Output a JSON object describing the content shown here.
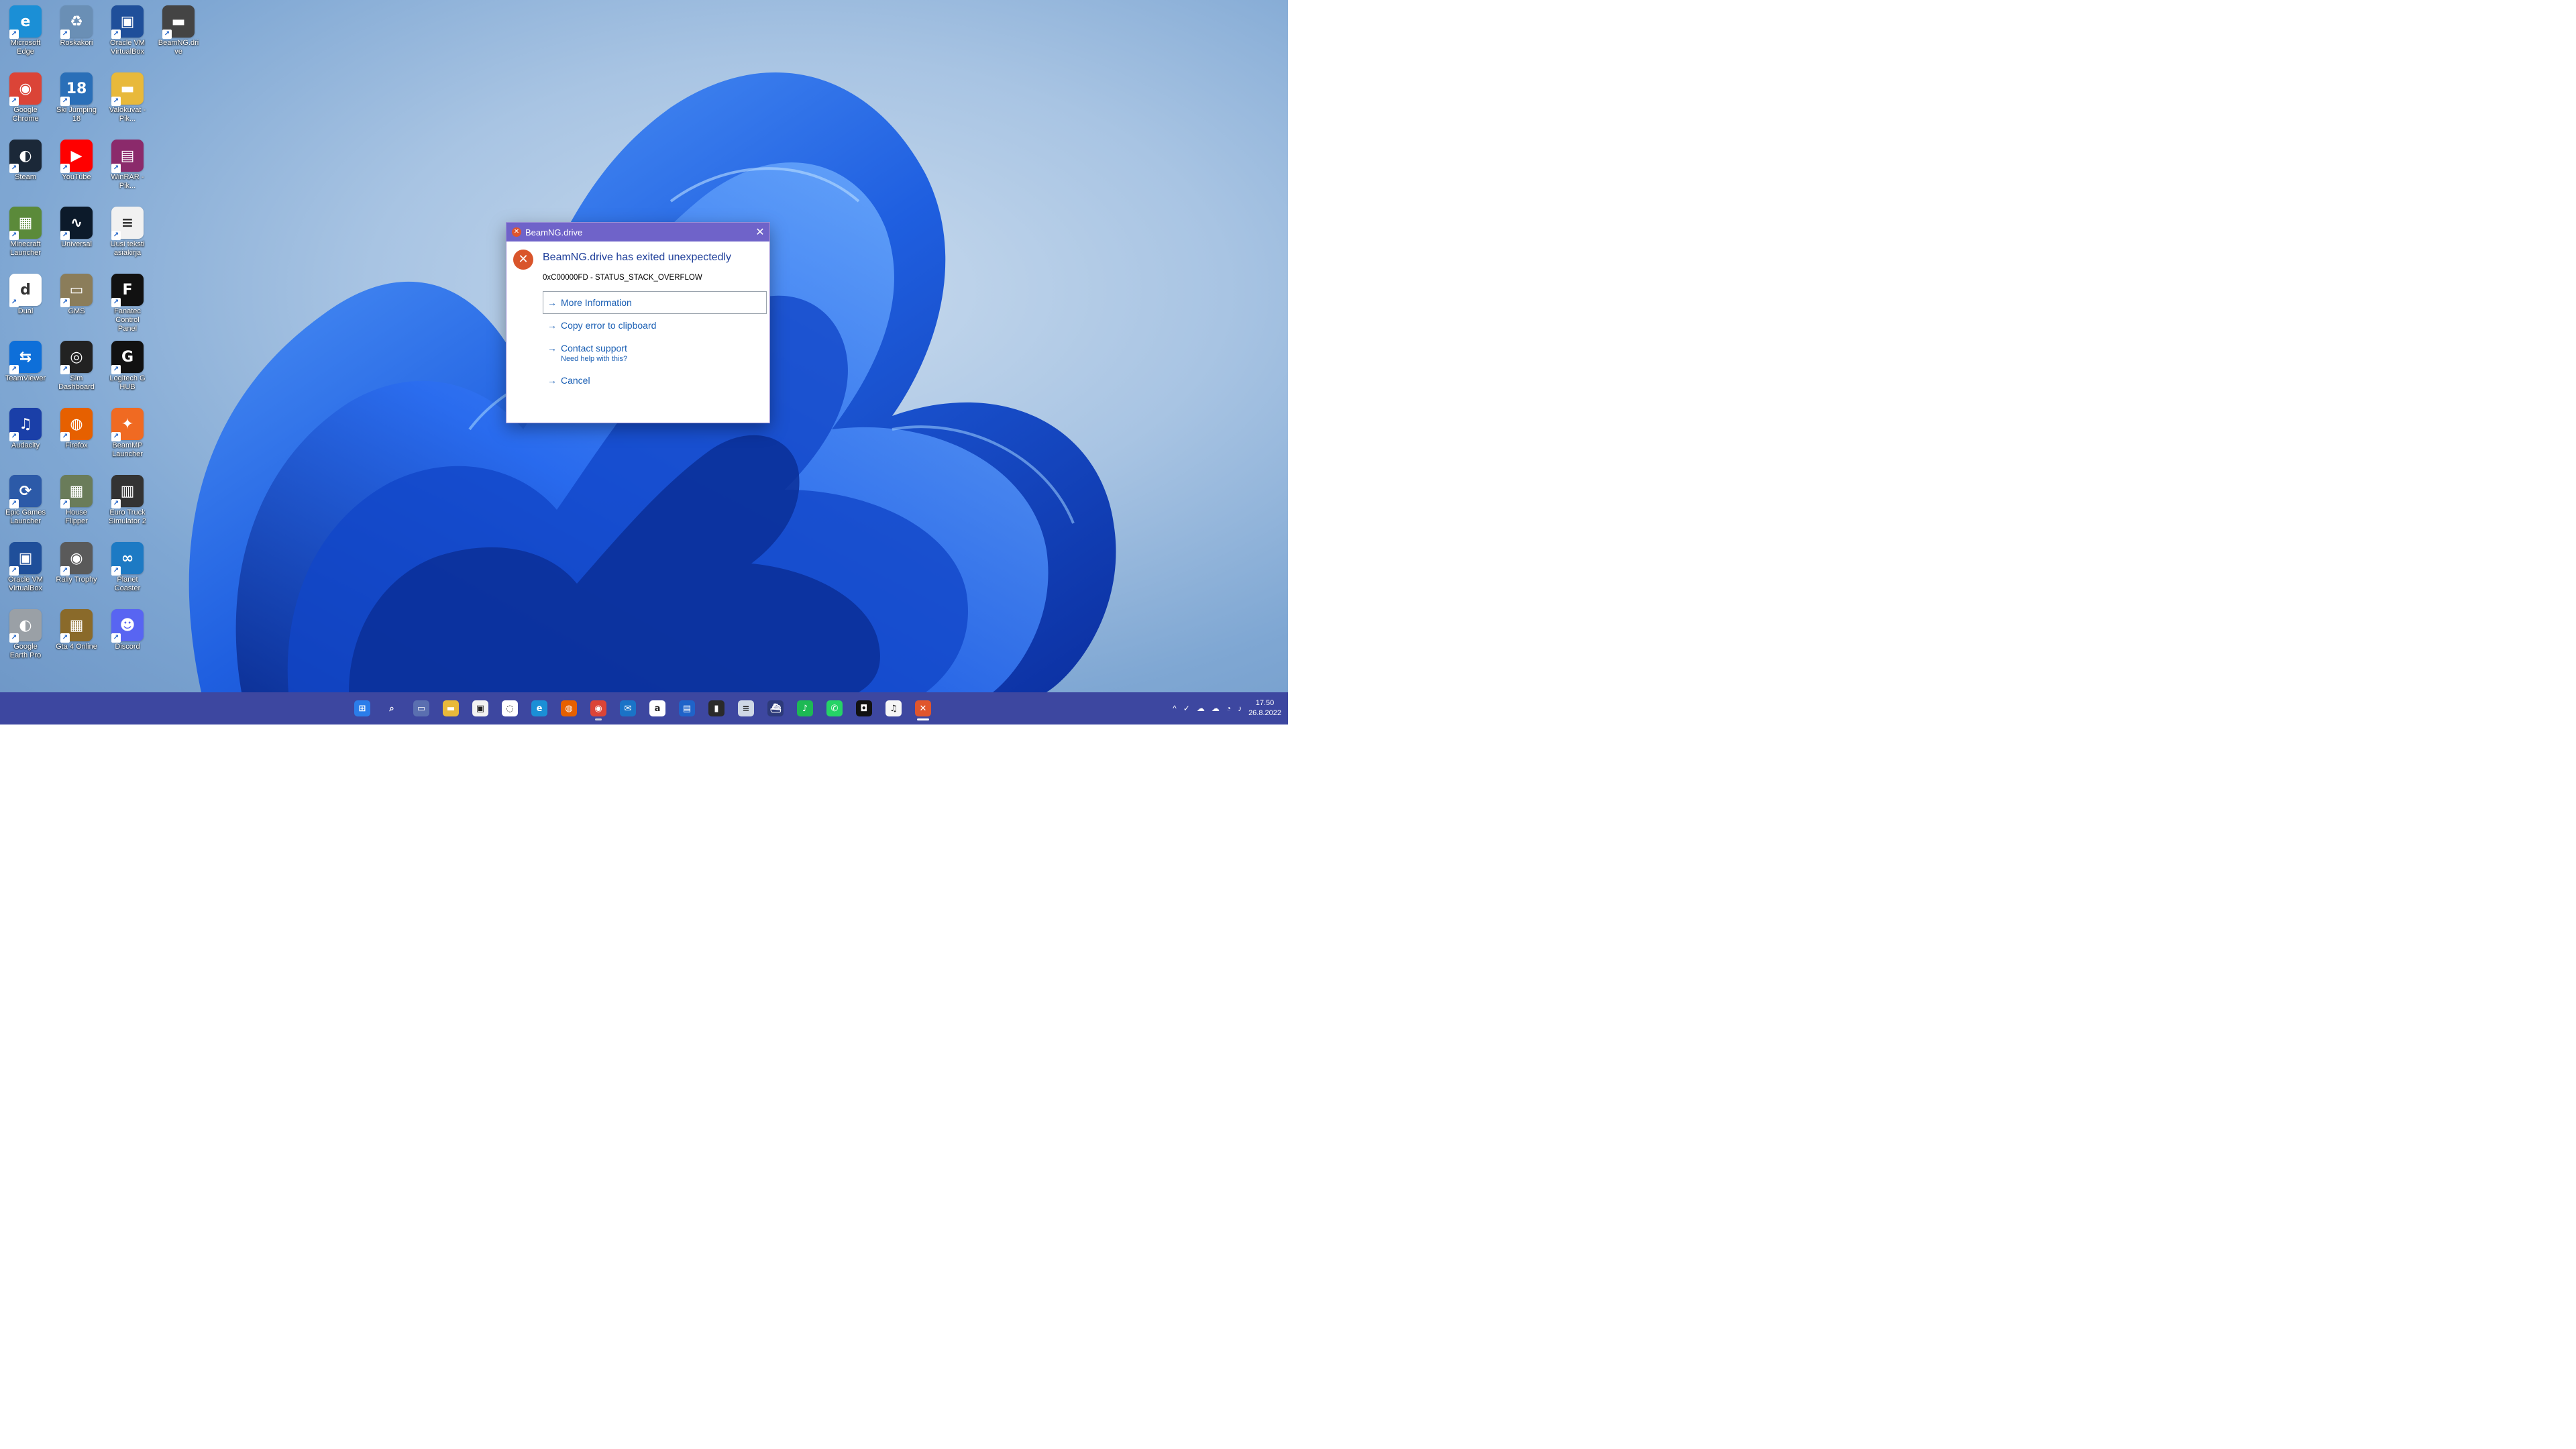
{
  "desktop": {
    "icons": [
      {
        "label": "Microsoft Edge",
        "glyph": "e",
        "color": "#1b8fd6",
        "icon": "edge-icon"
      },
      {
        "label": "Roskakori",
        "glyph": "♻",
        "color": "#6a8fb5",
        "icon": "recycle-bin-icon"
      },
      {
        "label": "Oracle VM VirtualBox",
        "glyph": "▣",
        "color": "#1f4f9a",
        "icon": "virtualbox-icon"
      },
      {
        "label": "BeamNG.drive",
        "glyph": "▬",
        "color": "#444444",
        "icon": "beamng-icon"
      },
      {
        "label": "Google Chrome",
        "glyph": "◉",
        "color": "#db4437",
        "icon": "chrome-icon"
      },
      {
        "label": "Ski Jumping 18",
        "glyph": "18",
        "color": "#2a6fb8",
        "icon": "game-icon"
      },
      {
        "label": "Valokuvat - Pik...",
        "glyph": "▬",
        "color": "#e8b93b",
        "icon": "folder-icon"
      },
      {
        "label": "Steam",
        "glyph": "◐",
        "color": "#1b2838",
        "icon": "steam-icon"
      },
      {
        "label": "YouTube",
        "glyph": "▶",
        "color": "#ff0000",
        "icon": "youtube-icon"
      },
      {
        "label": "WinRAR - Pik...",
        "glyph": "▤",
        "color": "#8b2a6b",
        "icon": "winrar-icon"
      },
      {
        "label": "Minecraft Launcher",
        "glyph": "▦",
        "color": "#5b8a3a",
        "icon": "minecraft-icon"
      },
      {
        "label": "Universal",
        "glyph": "∿",
        "color": "#0c1a2a",
        "icon": "audio-app-icon"
      },
      {
        "label": "Uusi teksti asiakirja",
        "glyph": "≡",
        "color": "#f1f1f1",
        "icon": "text-document-icon"
      },
      {
        "label": "Dual",
        "glyph": "d",
        "color": "#ffffff",
        "icon": "dual-app-icon"
      },
      {
        "label": "GMS",
        "glyph": "▭",
        "color": "#8b7d5a",
        "icon": "truck-game-icon"
      },
      {
        "label": "Fanatec Control Panel",
        "glyph": "F",
        "color": "#111111",
        "icon": "fanatec-icon"
      },
      {
        "label": "TeamViewer",
        "glyph": "⇆",
        "color": "#0e6fd9",
        "icon": "teamviewer-icon"
      },
      {
        "label": "Sim Dashboard",
        "glyph": "◎",
        "color": "#222222",
        "icon": "sim-dashboard-icon"
      },
      {
        "label": "Logitech G HUB",
        "glyph": "G",
        "color": "#111111",
        "icon": "logitech-icon"
      },
      {
        "label": "Audacity",
        "glyph": "♫",
        "color": "#1a3fa8",
        "icon": "audacity-icon"
      },
      {
        "label": "Firefox",
        "glyph": "◍",
        "color": "#e66000",
        "icon": "firefox-icon"
      },
      {
        "label": "BeamMP Launcher",
        "glyph": "✦",
        "color": "#f06a22",
        "icon": "beammp-icon"
      },
      {
        "label": "Epic Games Launcher",
        "glyph": "⟳",
        "color": "#2c5aa8",
        "icon": "sync-app-icon"
      },
      {
        "label": "House Flipper",
        "glyph": "▦",
        "color": "#6a7c5a",
        "icon": "house-flipper-icon"
      },
      {
        "label": "Euro Truck Simulator 2",
        "glyph": "▥",
        "color": "#333333",
        "icon": "ets2-icon"
      },
      {
        "label": "Oracle VM VirtualBox",
        "glyph": "▣",
        "color": "#1f4f9a",
        "icon": "virtualbox-icon"
      },
      {
        "label": "Rally Trophy",
        "glyph": "◉",
        "color": "#5a5a5a",
        "icon": "steering-wheel-icon"
      },
      {
        "label": "Planet Coaster",
        "glyph": "∞",
        "color": "#1d7ac4",
        "icon": "planet-coaster-icon"
      },
      {
        "label": "Google Earth Pro",
        "glyph": "◐",
        "color": "#9aa0a6",
        "icon": "google-earth-icon"
      },
      {
        "label": "Gta 4 Online",
        "glyph": "▦",
        "color": "#8a6a2a",
        "icon": "gta-icon"
      },
      {
        "label": "Discord",
        "glyph": "☻",
        "color": "#5865f2",
        "icon": "discord-icon"
      }
    ]
  },
  "dialog": {
    "title": "BeamNG.drive",
    "heading": "BeamNG.drive has exited unexpectedly",
    "error_code": "0xC00000FD - STATUS_STACK_OVERFLOW",
    "options": [
      {
        "label": "More Information",
        "sub": ""
      },
      {
        "label": "Copy error to clipboard",
        "sub": ""
      },
      {
        "label": "Contact support",
        "sub": "Need help with this?"
      },
      {
        "label": "Cancel",
        "sub": ""
      }
    ],
    "close_glyph": "✕"
  },
  "taskbar": {
    "apps": [
      {
        "name": "start-button",
        "glyph": "⊞",
        "color": "#2b7de9",
        "state": ""
      },
      {
        "name": "search-button",
        "glyph": "⌕",
        "color": "transparent",
        "state": ""
      },
      {
        "name": "task-view-button",
        "glyph": "▭",
        "color": "#5a6fb0",
        "state": ""
      },
      {
        "name": "file-explorer-button",
        "glyph": "▬",
        "color": "#e8b93b",
        "state": ""
      },
      {
        "name": "store-button",
        "glyph": "▣",
        "color": "#f2f2f2",
        "state": ""
      },
      {
        "name": "chat-button",
        "glyph": "◌",
        "color": "#ffffff",
        "state": ""
      },
      {
        "name": "edge-button",
        "glyph": "e",
        "color": "#1b8fd6",
        "state": ""
      },
      {
        "name": "firefox-button",
        "glyph": "◍",
        "color": "#e66000",
        "state": ""
      },
      {
        "name": "chrome-button",
        "glyph": "◉",
        "color": "#db4437",
        "state": "running"
      },
      {
        "name": "mail-button",
        "glyph": "✉",
        "color": "#1a73c7",
        "state": ""
      },
      {
        "name": "amazon-button",
        "glyph": "a",
        "color": "#ffffff",
        "state": ""
      },
      {
        "name": "outlook-button",
        "glyph": "▤",
        "color": "#1f63c9",
        "state": ""
      },
      {
        "name": "taskbar-app-button",
        "glyph": "▮",
        "color": "#2a2a2a",
        "state": ""
      },
      {
        "name": "notepad-button",
        "glyph": "≡",
        "color": "#cfd8e6",
        "state": ""
      },
      {
        "name": "ship-app-button",
        "glyph": "⛴",
        "color": "#2d3a7a",
        "state": ""
      },
      {
        "name": "spotify-button",
        "glyph": "♪",
        "color": "#1db954",
        "state": ""
      },
      {
        "name": "whatsapp-button",
        "glyph": "✆",
        "color": "#25d366",
        "state": ""
      },
      {
        "name": "camera-app-button",
        "glyph": "◘",
        "color": "#111111",
        "state": ""
      },
      {
        "name": "itunes-button",
        "glyph": "♫",
        "color": "#f6f6f6",
        "state": ""
      },
      {
        "name": "beamng-taskbar-button",
        "glyph": "✕",
        "color": "#e0552d",
        "state": "active"
      }
    ],
    "tray": {
      "chevron": "^",
      "icons": [
        "✓",
        "☁",
        "☁",
        "◔",
        "♪"
      ],
      "time": "17.50",
      "date": "26.8.2022"
    }
  }
}
